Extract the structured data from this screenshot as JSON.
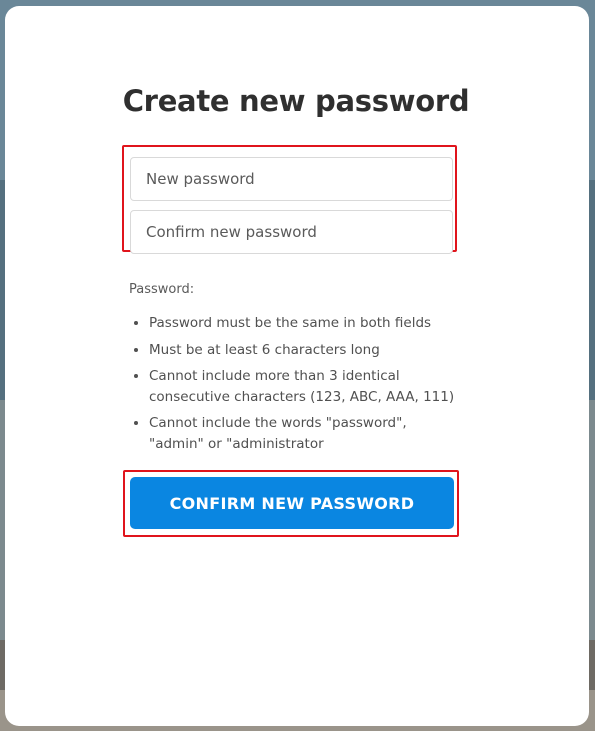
{
  "page": {
    "title": "Create new password"
  },
  "form": {
    "new_password_placeholder": "New password",
    "confirm_password_placeholder": "Confirm new password"
  },
  "requirements": {
    "heading": "Password:",
    "items": [
      "Password must be the same in both fields",
      "Must be at least 6 characters long",
      "Cannot include more than 3 identical consecutive characters (123, ABC, AAA, 111)",
      "Cannot include the words \"password\", \"admin\" or \"administrator"
    ]
  },
  "actions": {
    "confirm_label": "CONFIRM NEW PASSWORD"
  },
  "colors": {
    "primary_button": "#0a86e1",
    "highlight_outline": "#e0141c"
  }
}
